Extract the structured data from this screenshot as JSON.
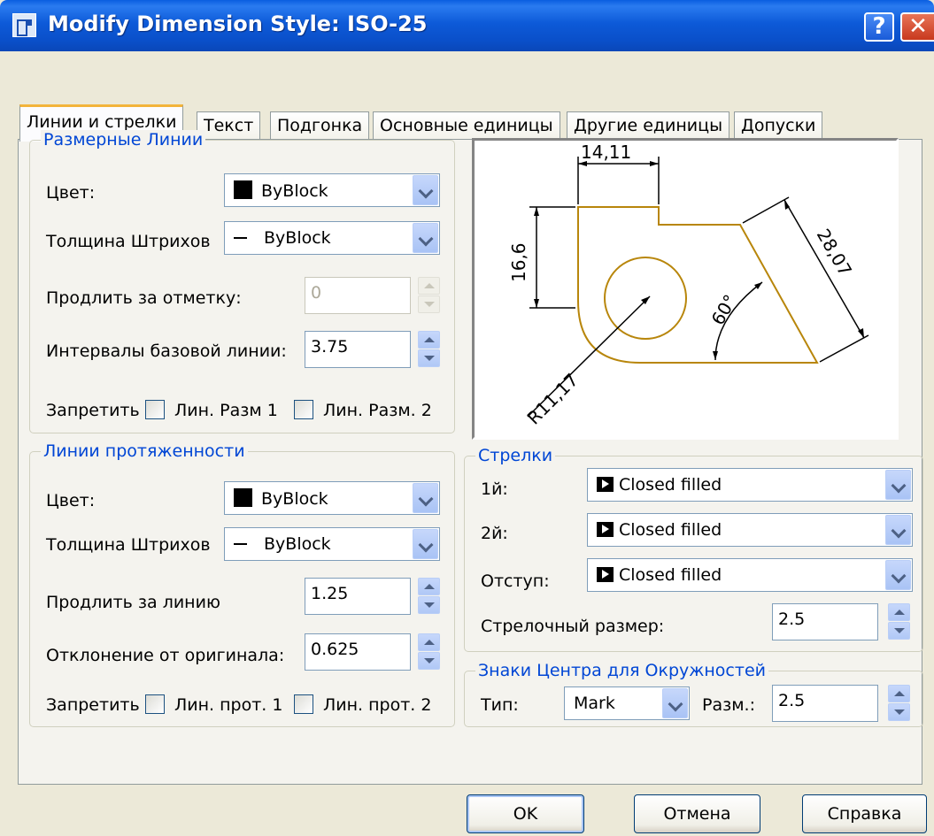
{
  "window": {
    "title": "Modify Dimension Style: ISO-25"
  },
  "tabs": [
    {
      "label": "Линии и стрелки",
      "active": true
    },
    {
      "label": "Текст"
    },
    {
      "label": "Подгонка"
    },
    {
      "label": "Основные единицы"
    },
    {
      "label": "Другие единицы"
    },
    {
      "label": "Допуски"
    }
  ],
  "dim_lines": {
    "legend": "Размерные Линии",
    "color_label": "Цвет:",
    "color_value": "ByBlock",
    "lineweight_label": "Толщина Штрихов",
    "lineweight_value": "ByBlock",
    "extend_label": "Продлить за отметку:",
    "extend_value": "0",
    "baseline_label": "Интервалы базовой линии:",
    "baseline_value": "3.75",
    "suppress_label": "Запретить",
    "suppress1": "Лин. Разм 1",
    "suppress2": "Лин. Разм. 2"
  },
  "ext_lines": {
    "legend": "Линии протяженности",
    "color_label": "Цвет:",
    "color_value": "ByBlock",
    "lineweight_label": "Толщина Штрихов",
    "lineweight_value": "ByBlock",
    "extend_label": "Продлить за линию",
    "extend_value": "1.25",
    "offset_label": "Отклонение от оригинала:",
    "offset_value": "0.625",
    "suppress_label": "Запретить",
    "suppress1": "Лин. прот. 1",
    "suppress2": "Лин. прот. 2"
  },
  "preview": {
    "dim_top": "14,11",
    "dim_left": "16,6",
    "dim_right": "28,07",
    "dim_angle": "60°",
    "dim_radius": "R11,17"
  },
  "arrows": {
    "legend": "Стрелки",
    "first_label": "1й:",
    "first_value": "Closed filled",
    "second_label": "2й:",
    "second_value": "Closed filled",
    "leader_label": "Отступ:",
    "leader_value": "Closed filled",
    "size_label": "Стрелочный размер:",
    "size_value": "2.5"
  },
  "center": {
    "legend": "Знаки Центра для Окружностей",
    "type_label": "Тип:",
    "type_value": "Mark",
    "size_label": "Разм.:",
    "size_value": "2.5"
  },
  "buttons": {
    "ok": "OK",
    "cancel": "Отмена",
    "help": "Справка"
  },
  "colors": {
    "titlebar": "#0a5ee0",
    "legend": "#0046d5",
    "preview_geometry": "#b8860b"
  }
}
